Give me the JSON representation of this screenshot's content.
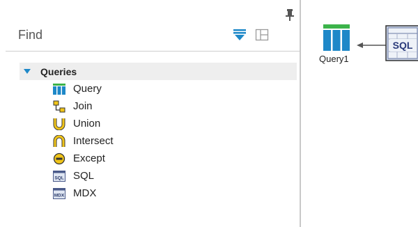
{
  "panel": {
    "find_label": "Find",
    "tree": {
      "root_label": "Queries",
      "items": [
        {
          "label": "Query",
          "icon": "query-icon"
        },
        {
          "label": "Join",
          "icon": "join-icon"
        },
        {
          "label": "Union",
          "icon": "union-icon"
        },
        {
          "label": "Intersect",
          "icon": "intersect-icon"
        },
        {
          "label": "Except",
          "icon": "except-icon"
        },
        {
          "label": "SQL",
          "icon": "sql-icon"
        },
        {
          "label": "MDX",
          "icon": "mdx-icon"
        }
      ]
    }
  },
  "canvas": {
    "query_node_label": "Query1",
    "sql_node_text": "SQL"
  },
  "colors": {
    "accent_blue": "#1e88c8",
    "query_green": "#3cb34a",
    "union_yellow": "#f0c419",
    "tree_header_bg": "#eeeeee"
  }
}
